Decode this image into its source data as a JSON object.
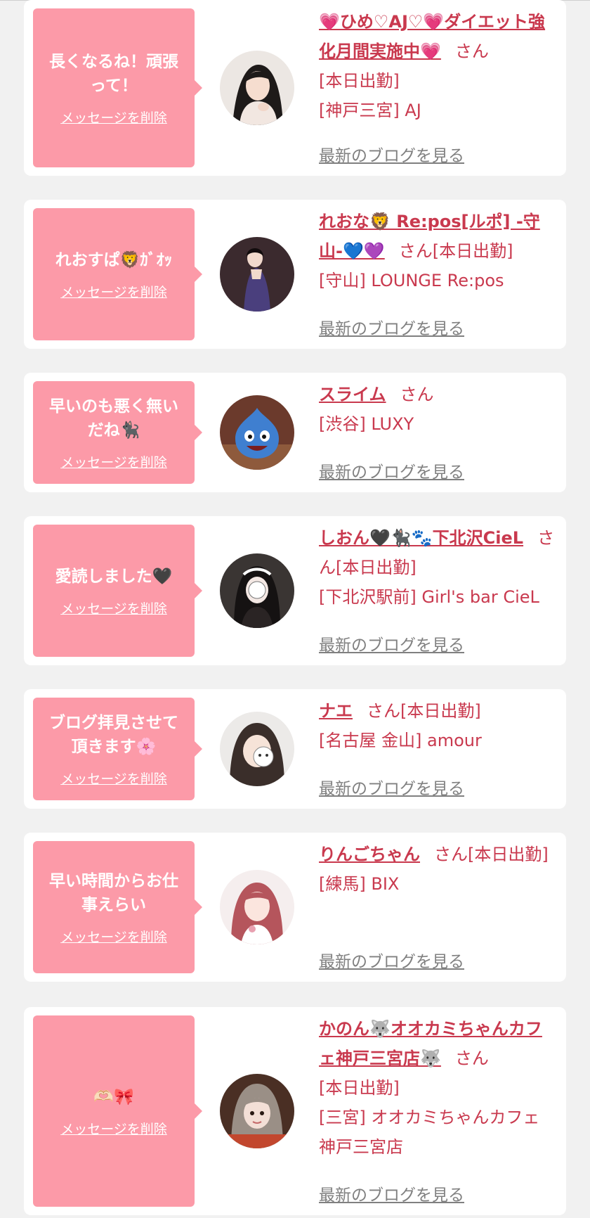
{
  "common": {
    "delete_label": "メッセージを削除",
    "blog_link": "最新のブログを見る",
    "san": "さん"
  },
  "colors": {
    "page_bg": "#f1f1f1",
    "bubble": "#fc9aa8",
    "accent_text": "#c9394e",
    "link_gray": "#808080"
  },
  "cards": [
    {
      "message": "長くなるね！頑張って！",
      "name": "💗ひめ♡AJ♡💗ダイエット強化月間実施中💗",
      "status": "[本日出勤]",
      "location": "[神戸三宮] AJ"
    },
    {
      "message": "れおすぱ🦁ｶﾞｵｯ",
      "name": "れおな🦁 Re:pos[ルポ] -守山-💙💜",
      "status": "[本日出勤]",
      "location": "[守山] LOUNGE Re:pos"
    },
    {
      "message": "早いのも悪く無いだね🐈‍⬛",
      "name": "スライム",
      "status": "",
      "location": "[渋谷] LUXY"
    },
    {
      "message": "愛読しました🖤",
      "name": "しおん🖤🐈‍⬛🐾下北沢CieL",
      "status": "[本日出勤]",
      "location": "[下北沢駅前] Girl's bar CieL"
    },
    {
      "message": "ブログ拝見させて頂きます🌸",
      "name": "ナエ",
      "status": "[本日出勤]",
      "location": "[名古屋 金山] amour"
    },
    {
      "message": "早い時間からお仕事えらい",
      "name": "りんごちゃん",
      "status": "[本日出勤]",
      "location": "[練馬] BIX"
    },
    {
      "message": "🫶🏻🎀",
      "name": "かのん🐺オオカミちゃんカフェ神戸三宮店🐺",
      "status": "[本日出勤]",
      "location": "[三宮] オオカミちゃんカフェ神戸三宮店"
    }
  ]
}
